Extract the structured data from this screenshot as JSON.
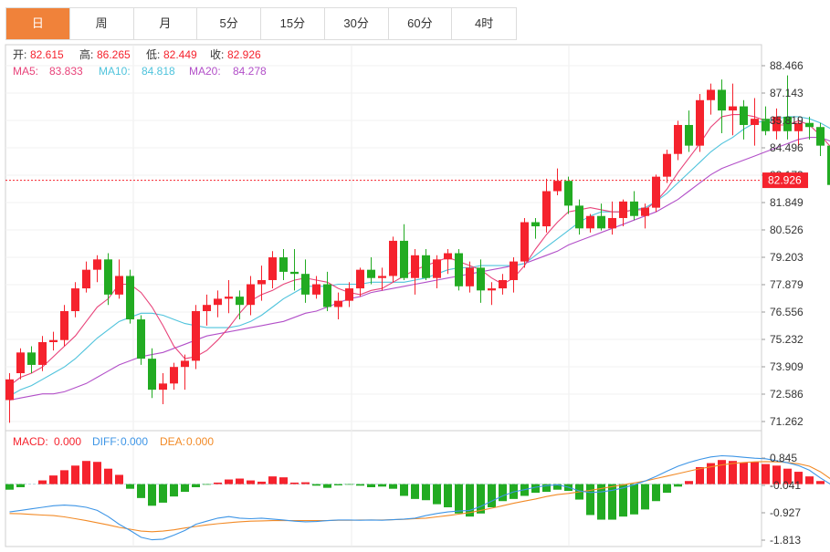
{
  "tabs": [
    {
      "label": "日",
      "active": true
    },
    {
      "label": "周",
      "active": false
    },
    {
      "label": "月",
      "active": false
    },
    {
      "label": "5分",
      "active": false
    },
    {
      "label": "15分",
      "active": false
    },
    {
      "label": "30分",
      "active": false
    },
    {
      "label": "60分",
      "active": false
    },
    {
      "label": "4时",
      "active": false
    }
  ],
  "ohlc": {
    "open_label": "开:",
    "open": "82.615",
    "high_label": "高:",
    "high": "86.265",
    "low_label": "低:",
    "low": "82.449",
    "close_label": "收:",
    "close": "82.926"
  },
  "ma_legend": {
    "ma5_label": "MA5:",
    "ma5": "83.833",
    "ma10_label": "MA10:",
    "ma10": "84.818",
    "ma20_label": "MA20:",
    "ma20": "84.278"
  },
  "macd_legend": {
    "macd_label": "MACD:",
    "macd": "0.000",
    "diff_label": "DIFF:",
    "diff": "0.000",
    "dea_label": "DEA:",
    "dea": "0.000"
  },
  "colors": {
    "up": "#f5222d",
    "down": "#22ab22",
    "ma5": "#e8437a",
    "ma10": "#4fc3dc",
    "ma20": "#b24fc8",
    "diff": "#3d95e6",
    "dea": "#f28a26",
    "active_tab": "#f0823a"
  },
  "chart_data": [
    {
      "type": "candlestick",
      "title": "",
      "price_axis_ticks": [
        "88.466",
        "87.143",
        "85.819",
        "84.496",
        "83.173",
        "81.849",
        "80.526",
        "79.203",
        "77.879",
        "76.556",
        "75.232",
        "73.909",
        "72.586",
        "71.262"
      ],
      "ylim": [
        71.262,
        88.466
      ],
      "current_price": "82.926",
      "ohlc": [
        [
          72.3,
          73.6,
          71.2,
          73.3
        ],
        [
          73.6,
          74.8,
          73.3,
          74.6
        ],
        [
          74.6,
          74.9,
          73.6,
          74.0
        ],
        [
          74.0,
          75.4,
          73.7,
          75.1
        ],
        [
          75.1,
          75.6,
          74.7,
          75.2
        ],
        [
          75.2,
          76.9,
          74.9,
          76.6
        ],
        [
          76.6,
          78.0,
          76.3,
          77.7
        ],
        [
          77.7,
          79.0,
          77.5,
          78.6
        ],
        [
          78.6,
          79.3,
          78.0,
          79.1
        ],
        [
          79.1,
          79.4,
          76.9,
          77.4
        ],
        [
          77.4,
          79.1,
          77.2,
          78.3
        ],
        [
          78.3,
          78.6,
          76.0,
          76.2
        ],
        [
          76.2,
          76.4,
          74.0,
          74.3
        ],
        [
          74.3,
          74.8,
          72.4,
          72.8
        ],
        [
          72.8,
          73.6,
          72.1,
          73.1
        ],
        [
          73.1,
          74.1,
          72.8,
          73.9
        ],
        [
          73.9,
          74.5,
          72.8,
          74.2
        ],
        [
          74.2,
          76.9,
          73.8,
          76.6
        ],
        [
          76.6,
          77.4,
          75.9,
          76.9
        ],
        [
          76.9,
          77.6,
          76.3,
          77.2
        ],
        [
          77.2,
          78.1,
          76.5,
          77.3
        ],
        [
          77.3,
          77.6,
          76.2,
          76.9
        ],
        [
          76.9,
          78.3,
          76.4,
          77.9
        ],
        [
          77.9,
          78.8,
          77.1,
          78.1
        ],
        [
          78.1,
          79.5,
          77.7,
          79.2
        ],
        [
          79.2,
          79.6,
          78.1,
          78.5
        ],
        [
          78.5,
          79.6,
          77.6,
          78.4
        ],
        [
          78.4,
          79.1,
          77.0,
          77.4
        ],
        [
          77.4,
          78.3,
          77.2,
          77.9
        ],
        [
          77.9,
          78.5,
          76.6,
          76.8
        ],
        [
          76.8,
          77.5,
          76.2,
          77.1
        ],
        [
          77.1,
          78.0,
          76.8,
          77.7
        ],
        [
          77.7,
          78.7,
          77.3,
          78.6
        ],
        [
          78.6,
          79.2,
          77.9,
          78.2
        ],
        [
          78.2,
          78.7,
          77.6,
          78.3
        ],
        [
          78.3,
          80.2,
          78.0,
          80.0
        ],
        [
          80.0,
          80.8,
          78.1,
          78.2
        ],
        [
          78.2,
          79.6,
          77.4,
          79.3
        ],
        [
          79.3,
          79.6,
          78.1,
          78.2
        ],
        [
          78.2,
          79.3,
          77.7,
          79.1
        ],
        [
          79.1,
          79.6,
          78.4,
          79.4
        ],
        [
          79.4,
          79.6,
          77.6,
          77.8
        ],
        [
          77.8,
          79.0,
          77.5,
          78.7
        ],
        [
          78.7,
          79.1,
          77.0,
          77.6
        ],
        [
          77.6,
          78.0,
          76.9,
          77.7
        ],
        [
          77.7,
          78.4,
          77.4,
          78.1
        ],
        [
          78.1,
          79.2,
          77.5,
          79.0
        ],
        [
          79.0,
          81.1,
          78.7,
          80.9
        ],
        [
          80.9,
          81.1,
          80.1,
          80.7
        ],
        [
          80.7,
          83.0,
          80.4,
          82.4
        ],
        [
          82.4,
          83.5,
          82.2,
          82.9
        ],
        [
          82.9,
          83.1,
          81.3,
          81.7
        ],
        [
          81.7,
          82.0,
          80.3,
          80.6
        ],
        [
          80.6,
          81.3,
          80.4,
          81.2
        ],
        [
          81.2,
          81.8,
          80.5,
          80.6
        ],
        [
          80.6,
          81.9,
          80.3,
          81.1
        ],
        [
          81.1,
          82.0,
          80.7,
          81.9
        ],
        [
          81.9,
          82.4,
          81.0,
          81.2
        ],
        [
          81.2,
          81.8,
          80.6,
          81.6
        ],
        [
          81.6,
          83.2,
          81.4,
          83.1
        ],
        [
          83.1,
          84.4,
          82.8,
          84.2
        ],
        [
          84.2,
          85.8,
          83.9,
          85.6
        ],
        [
          85.6,
          86.3,
          84.3,
          84.6
        ],
        [
          84.6,
          87.1,
          84.3,
          86.8
        ],
        [
          86.8,
          87.6,
          86.1,
          87.3
        ],
        [
          87.3,
          87.8,
          85.2,
          86.3
        ],
        [
          86.3,
          87.6,
          85.1,
          86.5
        ],
        [
          86.5,
          86.8,
          84.9,
          85.6
        ],
        [
          85.6,
          86.9,
          84.6,
          85.9
        ],
        [
          85.9,
          86.5,
          85.1,
          85.3
        ],
        [
          85.3,
          86.4,
          84.9,
          86.0
        ],
        [
          86.0,
          88.0,
          84.9,
          85.3
        ],
        [
          85.3,
          85.9,
          84.6,
          85.7
        ],
        [
          85.7,
          86.0,
          84.9,
          85.5
        ],
        [
          85.5,
          85.7,
          84.1,
          84.6
        ],
        [
          84.6,
          84.7,
          82.4,
          82.7
        ],
        [
          82.7,
          83.2,
          81.5,
          82.2
        ],
        [
          82.6,
          86.3,
          82.4,
          82.9
        ]
      ],
      "ma5": [
        73.0,
        73.4,
        73.6,
        73.9,
        74.4,
        74.9,
        75.4,
        76.1,
        76.8,
        77.2,
        77.9,
        77.9,
        77.5,
        76.8,
        75.9,
        74.9,
        74.3,
        74.4,
        74.7,
        75.2,
        75.8,
        76.5,
        77.1,
        77.4,
        77.6,
        77.9,
        78.1,
        78.2,
        78.1,
        78.0,
        77.7,
        77.5,
        77.4,
        77.6,
        77.7,
        78.0,
        78.3,
        78.6,
        78.8,
        79.0,
        79.2,
        79.0,
        78.8,
        78.6,
        78.2,
        77.9,
        78.2,
        78.8,
        79.6,
        80.3,
        80.9,
        81.4,
        81.5,
        81.6,
        81.5,
        81.4,
        81.4,
        81.5,
        81.5,
        81.9,
        82.5,
        83.3,
        84.0,
        84.7,
        85.5,
        86.0,
        86.1,
        86.1,
        86.0,
        85.8,
        85.6,
        85.6,
        85.8,
        85.6,
        85.1,
        84.5,
        83.8,
        83.1
      ],
      "ma10": [
        72.5,
        72.8,
        73.0,
        73.3,
        73.6,
        73.9,
        74.3,
        74.8,
        75.3,
        75.7,
        76.1,
        76.3,
        76.5,
        76.5,
        76.4,
        76.2,
        76.0,
        75.9,
        75.8,
        75.8,
        75.8,
        75.9,
        76.1,
        76.4,
        76.8,
        77.2,
        77.5,
        77.8,
        77.8,
        77.8,
        77.9,
        77.9,
        77.9,
        78.0,
        78.0,
        78.0,
        78.0,
        78.1,
        78.2,
        78.4,
        78.6,
        78.7,
        78.7,
        78.8,
        78.8,
        78.8,
        78.8,
        78.9,
        79.3,
        79.7,
        80.1,
        80.5,
        80.9,
        81.2,
        81.4,
        81.4,
        81.4,
        81.5,
        81.6,
        81.9,
        82.3,
        82.8,
        83.3,
        83.8,
        84.3,
        84.7,
        85.0,
        85.4,
        85.7,
        85.8,
        85.9,
        86.0,
        86.0,
        85.9,
        85.7,
        85.4,
        85.2,
        84.8
      ],
      "ma20": [
        72.3,
        72.4,
        72.5,
        72.6,
        72.6,
        72.7,
        72.9,
        73.1,
        73.4,
        73.7,
        74.0,
        74.2,
        74.4,
        74.5,
        74.6,
        74.8,
        75.0,
        75.2,
        75.4,
        75.5,
        75.6,
        75.7,
        75.8,
        75.9,
        76.0,
        76.1,
        76.3,
        76.5,
        76.6,
        76.8,
        77.0,
        77.2,
        77.3,
        77.5,
        77.6,
        77.7,
        77.8,
        77.9,
        78.0,
        78.1,
        78.2,
        78.3,
        78.4,
        78.5,
        78.6,
        78.7,
        78.8,
        78.9,
        79.1,
        79.3,
        79.5,
        79.8,
        80.0,
        80.2,
        80.4,
        80.6,
        80.8,
        81.0,
        81.2,
        81.4,
        81.7,
        82.0,
        82.4,
        82.8,
        83.2,
        83.5,
        83.7,
        83.9,
        84.1,
        84.3,
        84.5,
        84.7,
        84.9,
        85.0,
        85.0,
        84.8,
        84.5,
        84.3
      ]
    },
    {
      "type": "bar",
      "title": "",
      "indicator": "MACD",
      "y_axis_ticks": [
        "0.845",
        "-0.041",
        "-0.927",
        "-1.813"
      ],
      "ylim": [
        -1.813,
        0.845
      ],
      "macd": [
        -0.18,
        -0.1,
        0.0,
        0.12,
        0.28,
        0.45,
        0.6,
        0.75,
        0.72,
        0.5,
        0.3,
        -0.15,
        -0.45,
        -0.7,
        -0.6,
        -0.4,
        -0.25,
        -0.1,
        -0.02,
        0.05,
        0.15,
        0.18,
        0.12,
        0.08,
        0.25,
        0.22,
        0.05,
        0.06,
        -0.05,
        -0.12,
        -0.04,
        -0.02,
        -0.05,
        -0.1,
        -0.08,
        -0.15,
        -0.38,
        -0.48,
        -0.52,
        -0.65,
        -0.75,
        -0.95,
        -1.05,
        -0.95,
        -0.75,
        -0.55,
        -0.48,
        -0.38,
        -0.28,
        -0.25,
        -0.18,
        -0.22,
        -0.5,
        -1.0,
        -1.15,
        -1.15,
        -1.05,
        -0.98,
        -0.82,
        -0.55,
        -0.28,
        -0.08,
        0.1,
        0.55,
        0.68,
        0.78,
        0.75,
        0.7,
        0.72,
        0.65,
        0.6,
        0.5,
        0.4,
        0.25,
        0.1,
        0.0,
        0.0,
        0.0
      ],
      "diff": [
        -0.9,
        -0.85,
        -0.8,
        -0.75,
        -0.7,
        -0.68,
        -0.7,
        -0.75,
        -0.85,
        -1.05,
        -1.3,
        -1.5,
        -1.72,
        -1.8,
        -1.78,
        -1.65,
        -1.5,
        -1.3,
        -1.2,
        -1.1,
        -1.05,
        -1.1,
        -1.12,
        -1.1,
        -1.13,
        -1.16,
        -1.2,
        -1.22,
        -1.21,
        -1.18,
        -1.16,
        -1.16,
        -1.17,
        -1.16,
        -1.17,
        -1.15,
        -1.13,
        -1.1,
        -1.02,
        -0.95,
        -0.9,
        -0.87,
        -0.85,
        -0.72,
        -0.55,
        -0.38,
        -0.25,
        -0.18,
        -0.1,
        -0.05,
        -0.02,
        -0.1,
        -0.22,
        -0.27,
        -0.25,
        -0.2,
        -0.12,
        -0.02,
        0.1,
        0.25,
        0.42,
        0.58,
        0.7,
        0.8,
        0.88,
        0.92,
        0.9,
        0.87,
        0.84,
        0.82,
        0.76,
        0.69,
        0.6,
        0.45,
        0.2,
        -0.02,
        -0.05,
        0.0
      ],
      "dea": [
        -0.95,
        -0.96,
        -0.98,
        -1.0,
        -1.02,
        -1.06,
        -1.12,
        -1.18,
        -1.25,
        -1.32,
        -1.4,
        -1.46,
        -1.52,
        -1.54,
        -1.52,
        -1.48,
        -1.42,
        -1.37,
        -1.32,
        -1.28,
        -1.25,
        -1.22,
        -1.2,
        -1.19,
        -1.18,
        -1.18,
        -1.18,
        -1.18,
        -1.18,
        -1.18,
        -1.17,
        -1.17,
        -1.16,
        -1.16,
        -1.16,
        -1.15,
        -1.14,
        -1.12,
        -1.1,
        -1.06,
        -1.02,
        -0.97,
        -0.92,
        -0.85,
        -0.78,
        -0.7,
        -0.62,
        -0.55,
        -0.48,
        -0.4,
        -0.34,
        -0.3,
        -0.25,
        -0.2,
        -0.14,
        -0.08,
        -0.02,
        0.04,
        0.1,
        0.18,
        0.26,
        0.34,
        0.42,
        0.5,
        0.56,
        0.62,
        0.67,
        0.7,
        0.72,
        0.73,
        0.72,
        0.7,
        0.66,
        0.58,
        0.4,
        0.15,
        -0.03,
        0.0
      ]
    }
  ]
}
